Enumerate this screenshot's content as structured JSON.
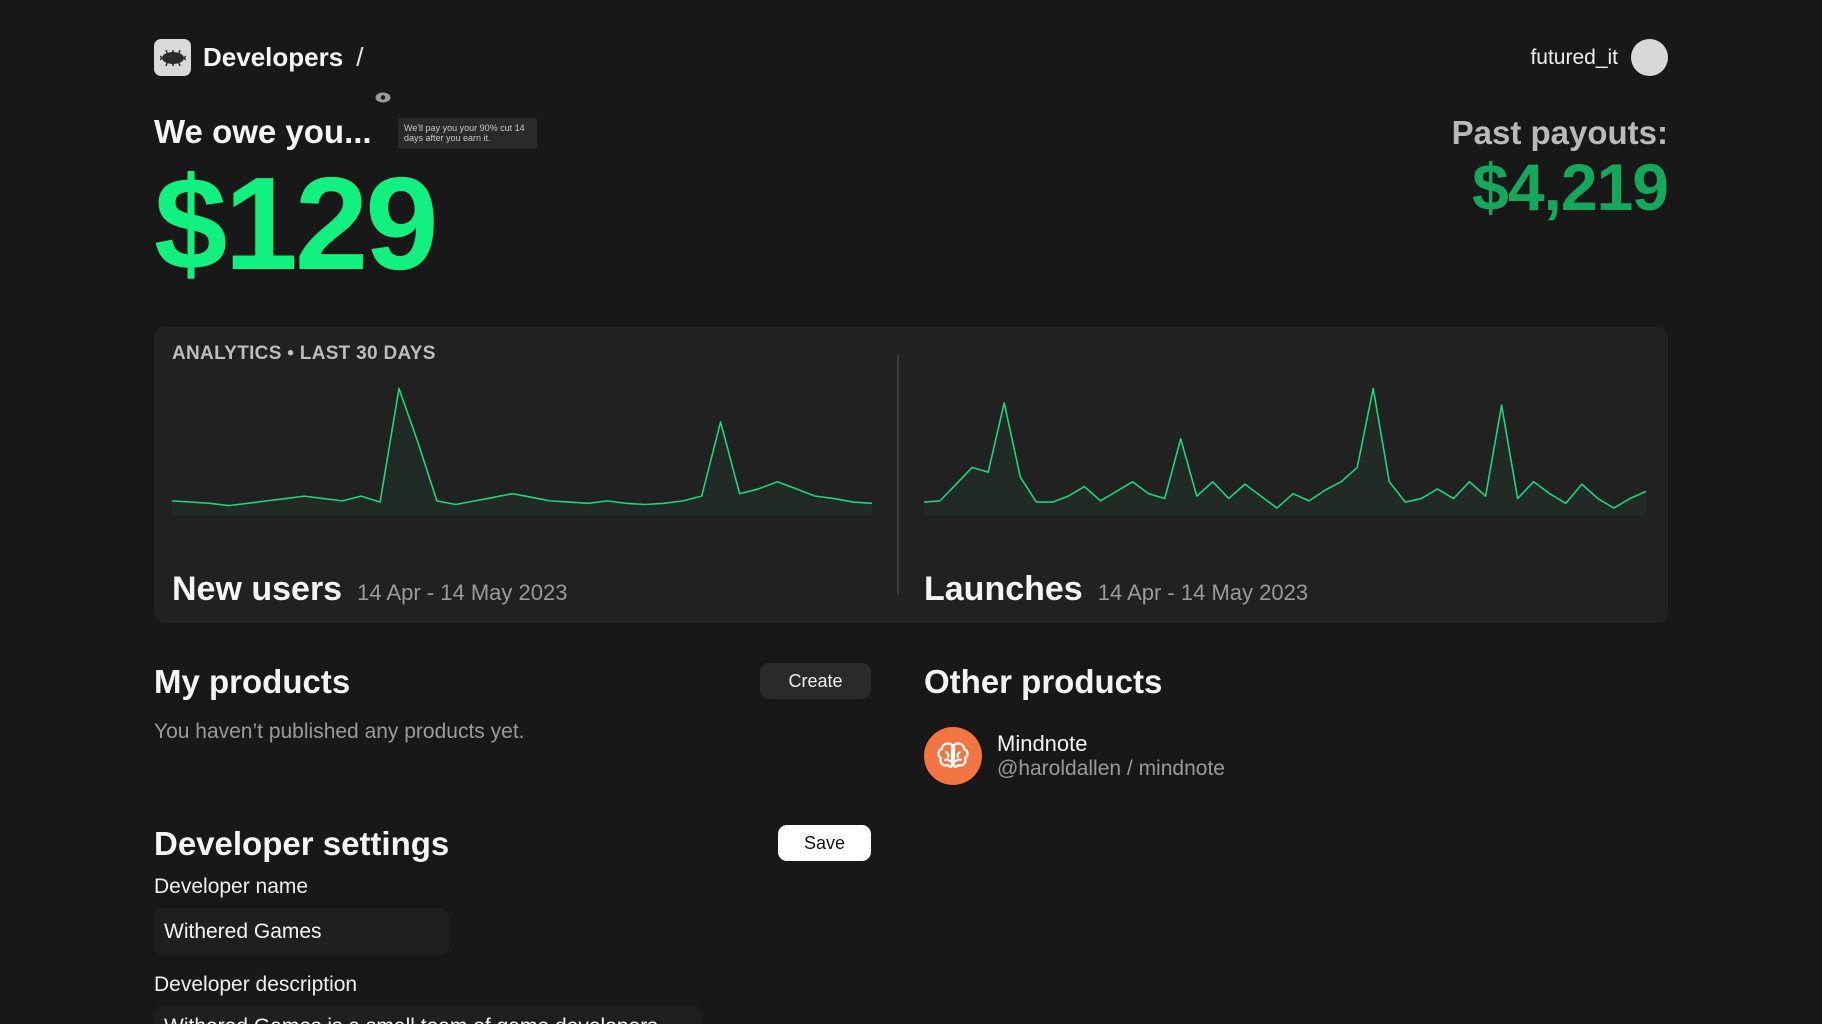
{
  "header": {
    "brand_title": "Developers",
    "breadcrumb_separator": "/",
    "username": "futured_it"
  },
  "earnings": {
    "owe_label": "We owe you...",
    "owe_tooltip": "We'll pay you your 90% cut 14 days after you earn it.",
    "owe_amount": "$129",
    "past_label": "Past payouts:",
    "past_amount": "$4,219"
  },
  "analytics": {
    "title": "ANALYTICS • LAST 30 DAYS"
  },
  "chart_data": [
    {
      "type": "line",
      "title": "New users",
      "subtitle": "14 Apr - 14 May 2023",
      "values": [
        0.06,
        0.05,
        0.04,
        0.02,
        0.04,
        0.06,
        0.08,
        0.1,
        0.08,
        0.06,
        0.1,
        0.05,
        1.0,
        0.55,
        0.06,
        0.03,
        0.06,
        0.09,
        0.12,
        0.09,
        0.06,
        0.05,
        0.04,
        0.06,
        0.04,
        0.03,
        0.04,
        0.06,
        0.1,
        0.72,
        0.12,
        0.16,
        0.22,
        0.16,
        0.1,
        0.08,
        0.05,
        0.04
      ],
      "color": "#1fd47a"
    },
    {
      "type": "line",
      "title": "Launches",
      "subtitle": "14 Apr - 14 May 2023",
      "values": [
        0.05,
        0.06,
        0.2,
        0.34,
        0.3,
        0.88,
        0.26,
        0.05,
        0.05,
        0.1,
        0.18,
        0.06,
        0.14,
        0.22,
        0.12,
        0.08,
        0.58,
        0.1,
        0.22,
        0.08,
        0.2,
        0.1,
        0.0,
        0.12,
        0.06,
        0.15,
        0.22,
        0.34,
        1.0,
        0.22,
        0.05,
        0.08,
        0.16,
        0.08,
        0.22,
        0.1,
        0.86,
        0.08,
        0.22,
        0.12,
        0.04,
        0.2,
        0.08,
        0.0,
        0.08,
        0.14
      ],
      "color": "#1fd47a"
    }
  ],
  "my_products": {
    "title": "My products",
    "create_label": "Create",
    "empty_text": "You haven’t published any products yet."
  },
  "other_products": {
    "title": "Other products",
    "items": [
      {
        "name": "Mindnote",
        "handle": "@haroldallen / mindnote",
        "icon": "brain-icon",
        "icon_color": "#f37543"
      }
    ]
  },
  "settings": {
    "title": "Developer settings",
    "save_label": "Save",
    "name_label": "Developer name",
    "name_value": "Withered Games",
    "description_label": "Developer description",
    "description_value": "Withered Games is a small team of game developers"
  },
  "colors": {
    "background": "#181818",
    "accent": "#12f07f",
    "accent_dark": "#15a85c",
    "card": "#212121"
  }
}
